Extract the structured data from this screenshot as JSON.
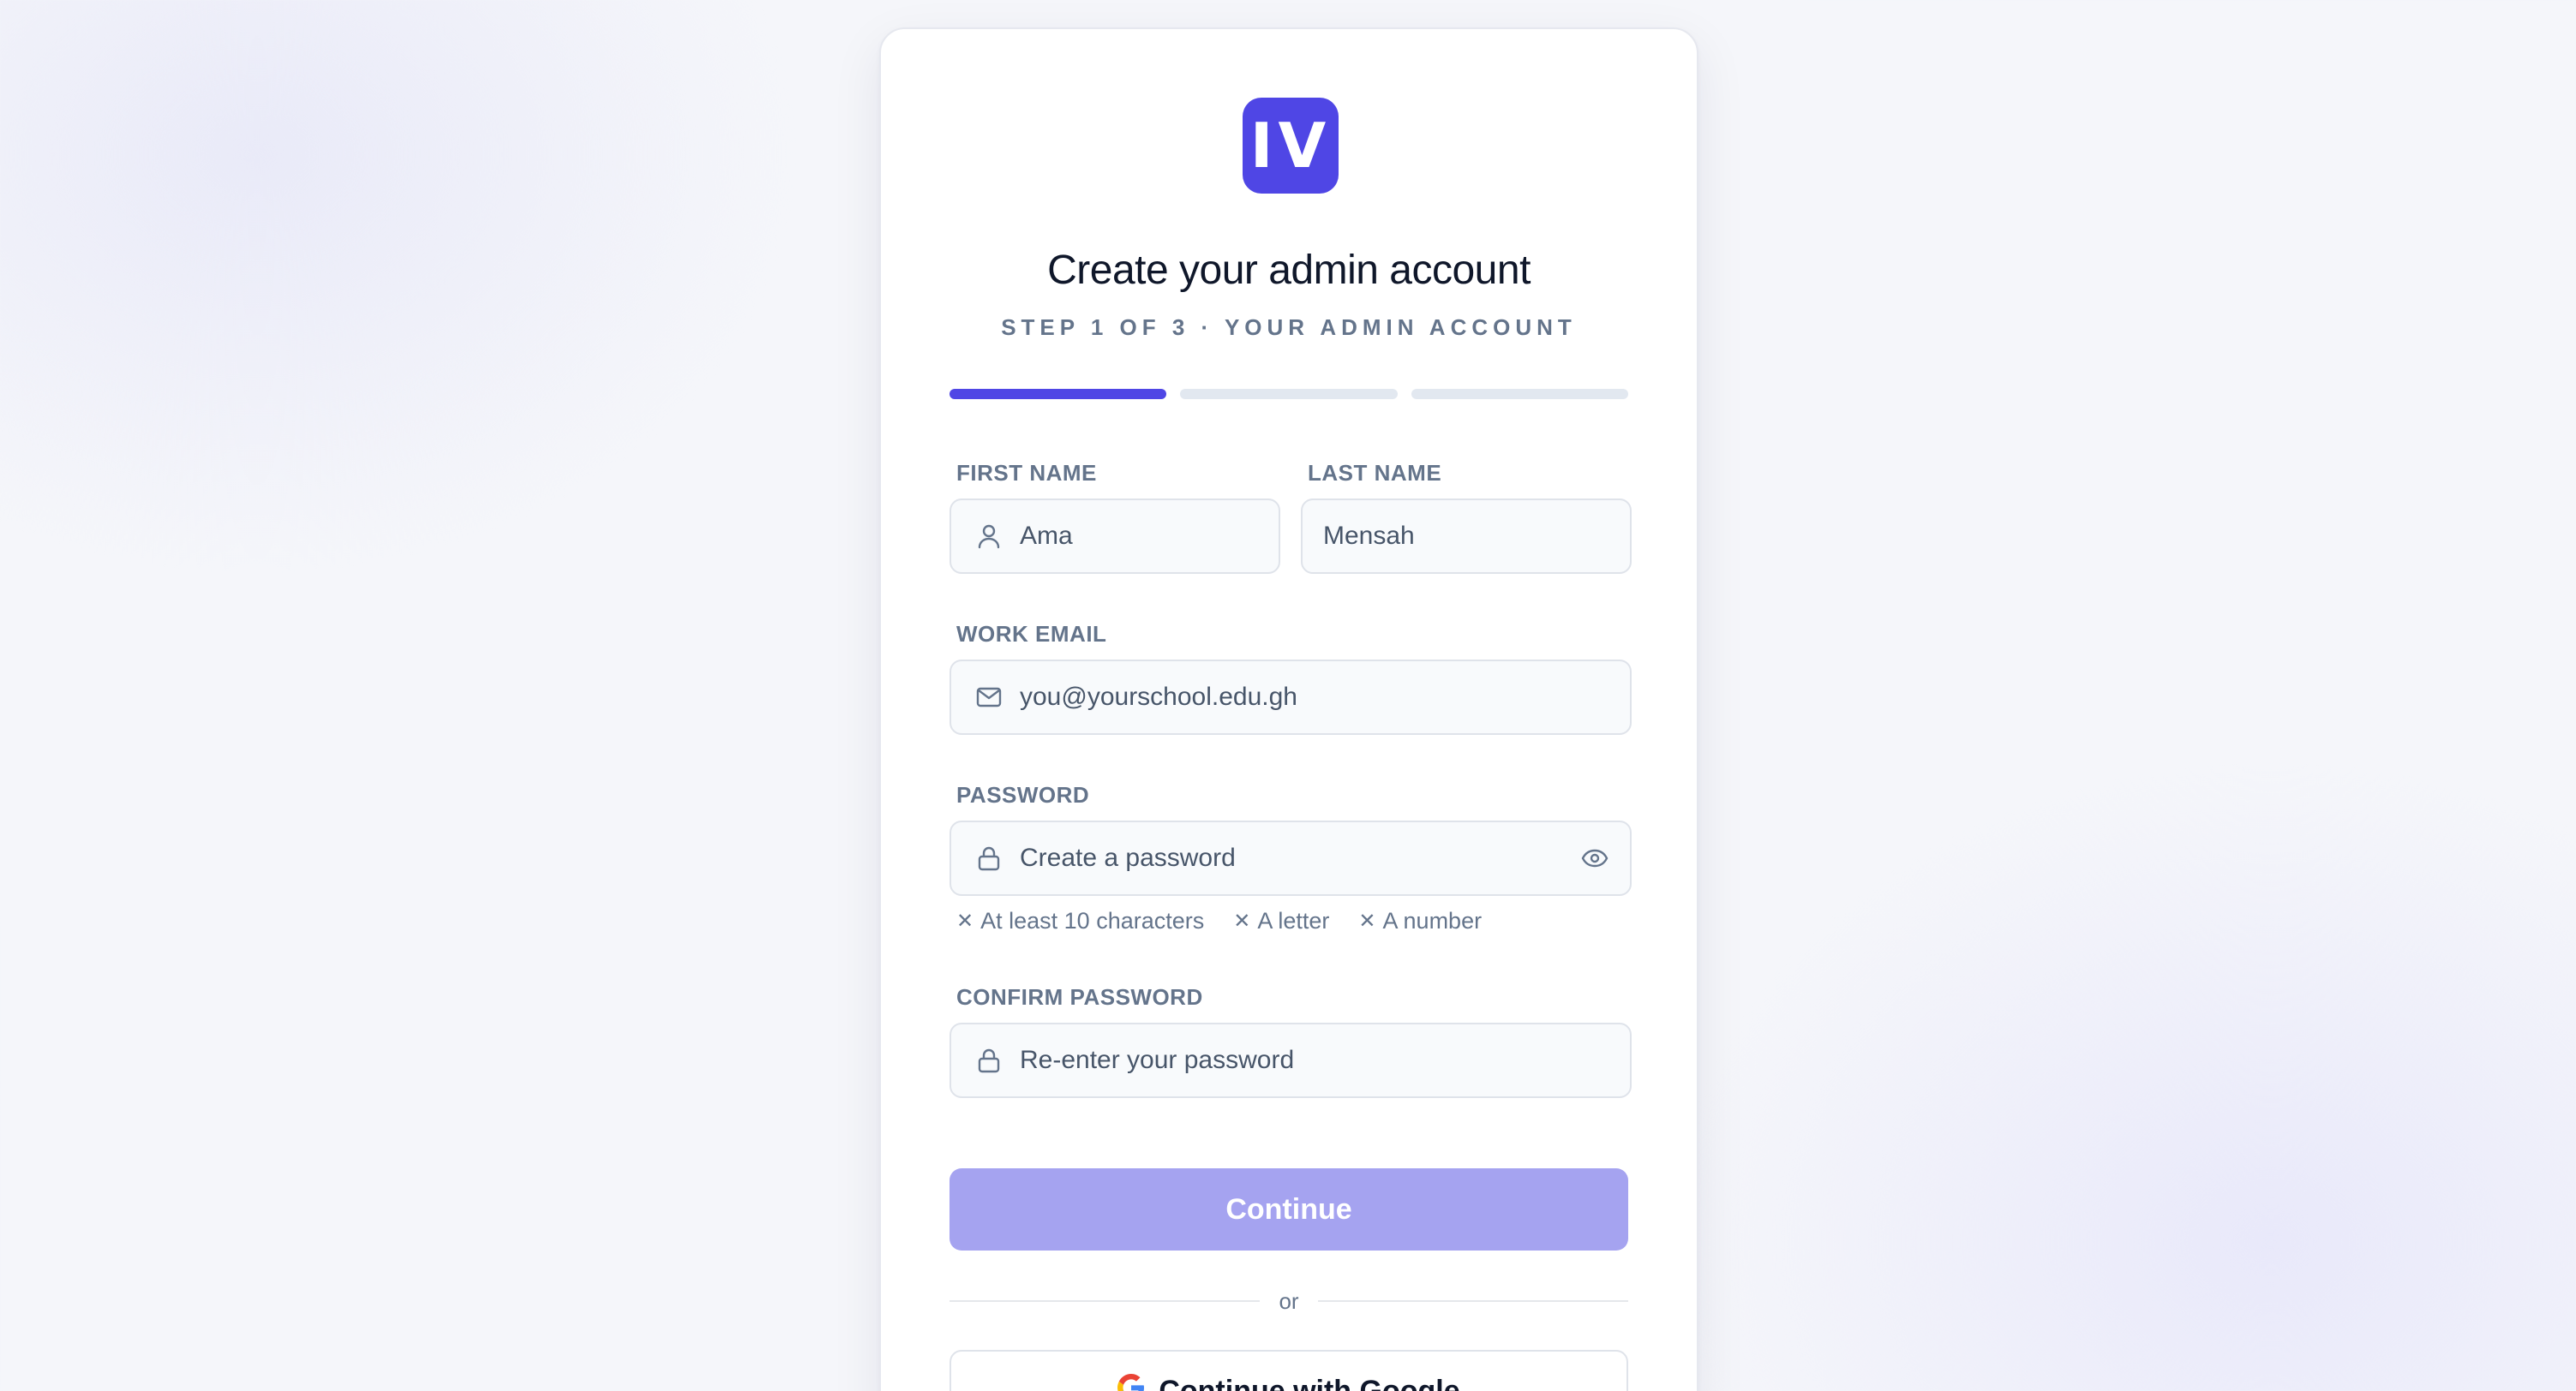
{
  "brand": {
    "logo_text": "IV",
    "accent": "#4f46e5",
    "button_disabled": "#a5a3f0"
  },
  "header": {
    "title": "Create your admin account",
    "subtitle": "STEP 1 OF 3 · YOUR ADMIN ACCOUNT"
  },
  "progress": {
    "current_step": 1,
    "total_steps": 3
  },
  "form": {
    "first_name": {
      "label": "FIRST NAME",
      "value": "Ama",
      "icon": "user-icon"
    },
    "last_name": {
      "label": "LAST NAME",
      "value": "Mensah"
    },
    "email": {
      "label": "WORK EMAIL",
      "placeholder": "you@yourschool.edu.gh",
      "icon": "mail-icon"
    },
    "password": {
      "label": "PASSWORD",
      "placeholder": "Create a password",
      "icon": "lock-icon",
      "toggle_icon": "eye-icon",
      "rules": [
        {
          "text": "At least 10 characters",
          "met": false
        },
        {
          "text": "A letter",
          "met": false
        },
        {
          "text": "A number",
          "met": false
        }
      ]
    },
    "confirm_password": {
      "label": "CONFIRM PASSWORD",
      "placeholder": "Re-enter your password",
      "icon": "lock-icon"
    }
  },
  "actions": {
    "continue_label": "Continue",
    "divider_text": "or",
    "google_label": "Continue with Google"
  }
}
